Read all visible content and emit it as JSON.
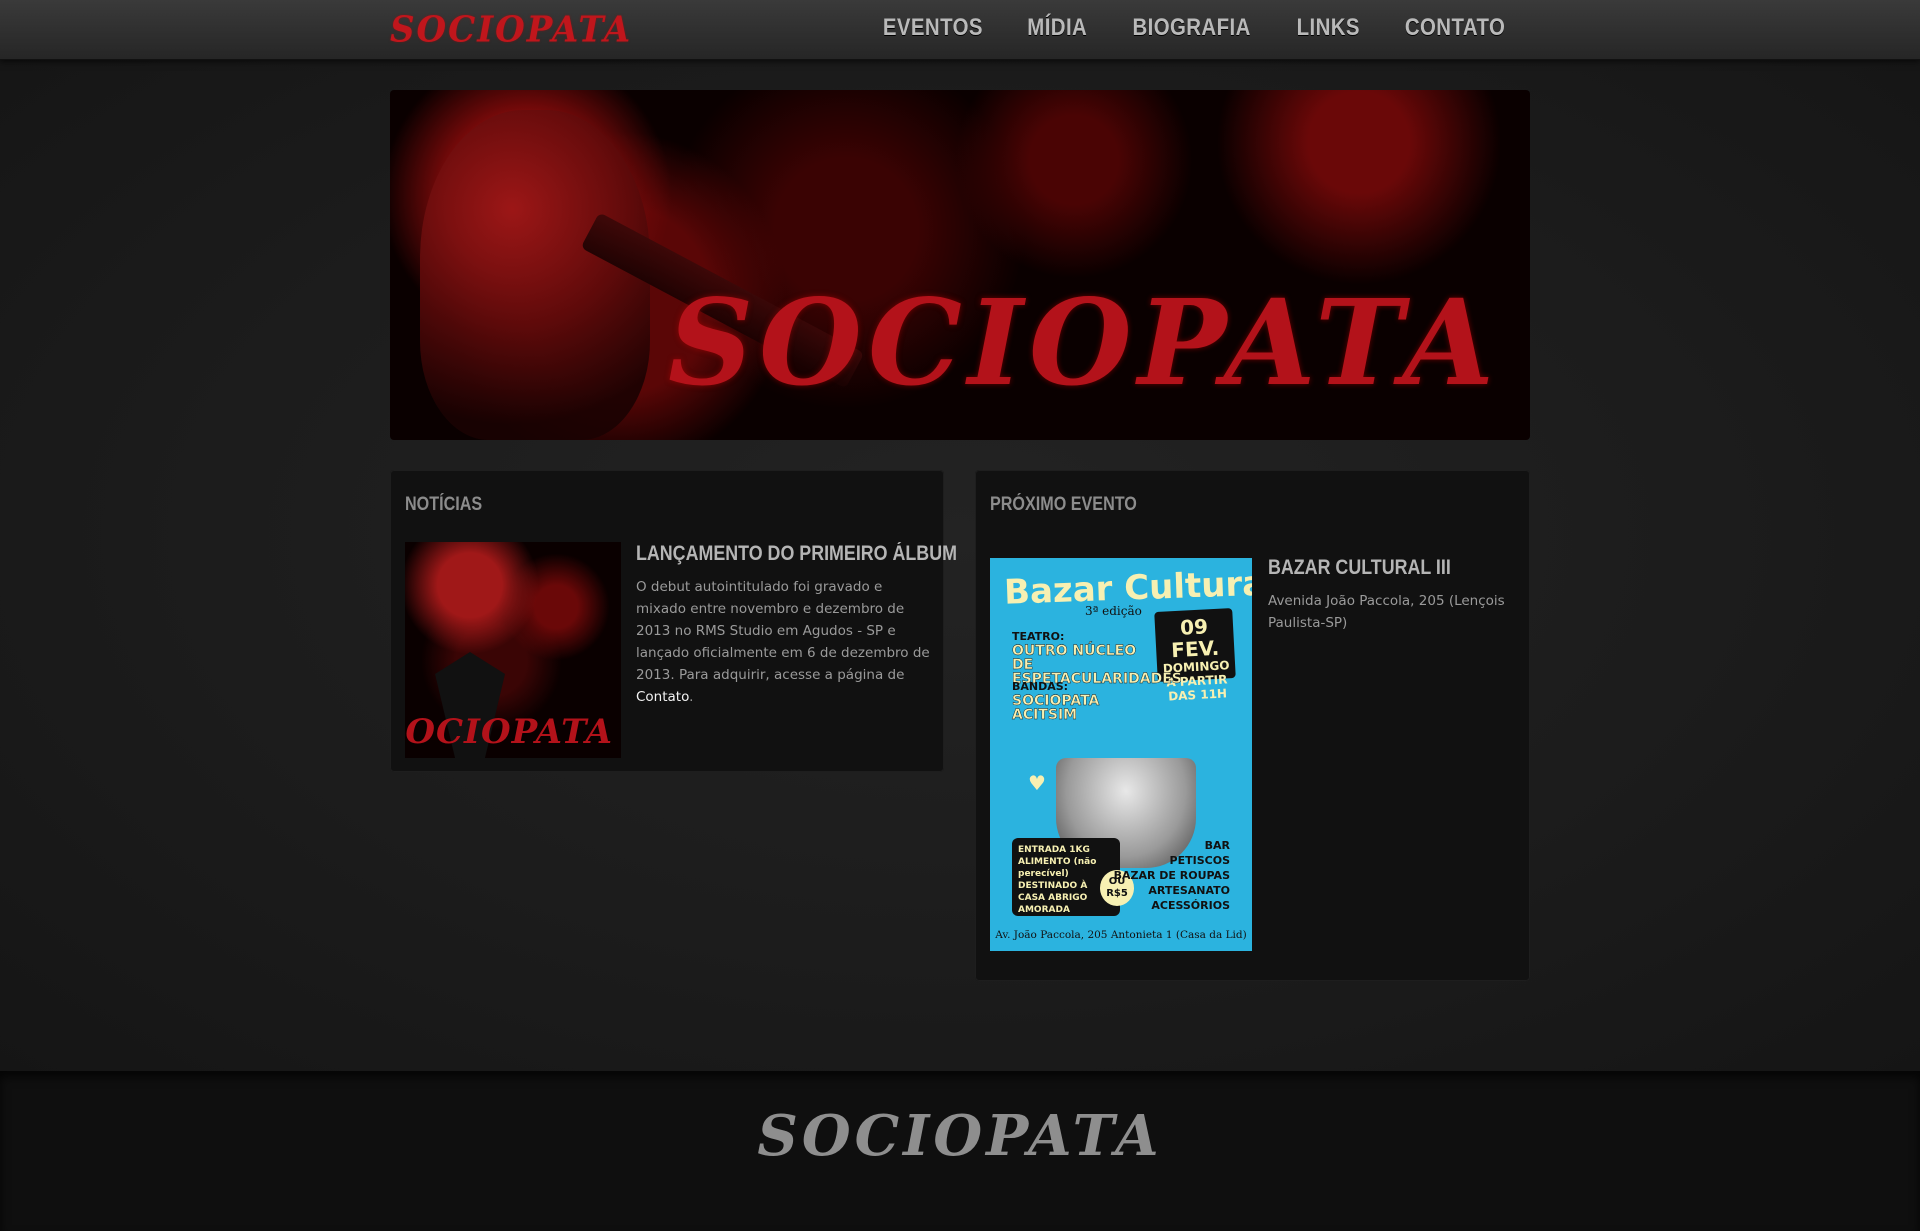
{
  "nav": {
    "brand": "SOCIOPATA",
    "items": [
      "EVENTOS",
      "MÍDIA",
      "BIOGRAFIA",
      "LINKS",
      "CONTATO"
    ]
  },
  "hero": {
    "title": "SOCIOPATA"
  },
  "news": {
    "heading": "NOTÍCIAS",
    "item": {
      "thumb_text": "SOCIOPATA",
      "title": "LANÇAMENTO DO PRIMEIRO ÁLBUM",
      "body": "O debut autointitulado foi gravado e mixado entre novembro e dezembro de 2013 no RMS Studio em Agudos - SP e lançado oficialmente em 6 de dezembro de 2013. Para adquirir, acesse a página de ",
      "link": "Contato",
      "body_end": "."
    }
  },
  "event": {
    "heading": "PRÓXIMO EVENTO",
    "title": "BAZAR CULTURAL III",
    "address": "Avenida João Paccola, 205 (Lençois Paulista-SP)",
    "poster": {
      "title": "Bazar Cultural",
      "edition": "3ª edição",
      "date_top": "09 FEV.",
      "date_day": "DOMINGO",
      "date_time": "A PARTIR DAS 11H",
      "teatro_label": "TEATRO:",
      "teatro": "OUTRO NÚCLEO DE ESPETACULARIDADES",
      "bandas_label": "BANDAS:",
      "band1": "SOCIOPATA",
      "band2": "ACITSIM",
      "entrada": "ENTRADA 1KG ALIMENTO (não perecível) DESTINADO À CASA ABRIGO AMORADA",
      "ou": "OU R$5",
      "extras": [
        "BAR",
        "PETISCOS",
        "BAZAR DE ROUPAS",
        "ARTESANATO",
        "ACESSÓRIOS"
      ],
      "address": "Av. João Paccola, 205 Antonieta 1 (Casa da Lid)"
    }
  },
  "footer": {
    "logo": "SOCIOPATA"
  },
  "colors": {
    "accent": "#b3121a",
    "poster_bg": "#2bb3df",
    "poster_yellow": "#f7f0b2"
  }
}
